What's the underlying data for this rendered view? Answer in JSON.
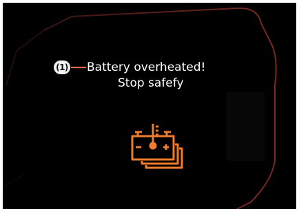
{
  "warning": {
    "callout_number": "(1)",
    "message_line1": "Battery overheated!",
    "message_line2": "Stop safefy",
    "icon": "battery-overheat-icon",
    "icon_color": "#f07d2c"
  },
  "colors": {
    "background": "#000000",
    "frame_outline": "#5a1f1a",
    "callout_line": "#e86a43",
    "text": "#ffffff"
  }
}
